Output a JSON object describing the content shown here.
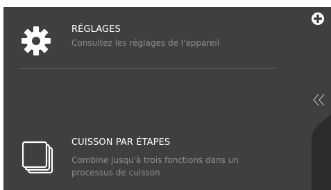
{
  "menu": {
    "items": [
      {
        "title": "RÉGLAGES",
        "description": "Consultez les réglages de l'appareil",
        "icon": "gear-icon"
      },
      {
        "title": "CUISSON PAR ÉTAPES",
        "description": "Combine jusqu'à trois fonctions dans un processus de cuisson",
        "icon": "stacked-pages-icon"
      }
    ]
  },
  "controls": {
    "add_icon": "plus-circle-icon",
    "collapse_icon": "double-chevron-left-icon"
  },
  "colors": {
    "background": "#3f3f3f",
    "title": "#ffffff",
    "description": "#8e8e8e",
    "divider": "#5e5e5e"
  }
}
